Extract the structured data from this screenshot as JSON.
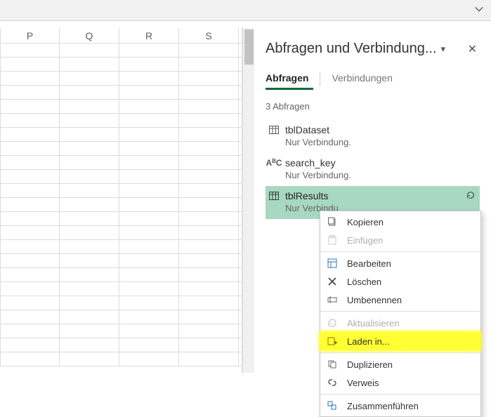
{
  "columns": [
    "P",
    "Q",
    "R",
    "S"
  ],
  "pane": {
    "title": "Abfragen und Verbindung...",
    "tabs": {
      "active": "Abfragen",
      "inactive": "Verbindungen"
    },
    "count": "3 Abfragen",
    "queries": [
      {
        "name": "tblDataset",
        "sub": "Nur Verbindung.",
        "kind": "table"
      },
      {
        "name": "search_key",
        "sub": "Nur Verbindung.",
        "kind": "text"
      },
      {
        "name": "tblResults",
        "sub": "Nur Verbindu",
        "kind": "table"
      }
    ]
  },
  "menu": {
    "copy": "Kopieren",
    "paste": "Einfügen",
    "edit": "Bearbeiten",
    "delete": "Löschen",
    "rename": "Umbenennen",
    "refresh": "Aktualisieren",
    "loadto": "Laden in...",
    "duplicate": "Duplizieren",
    "reference": "Verweis",
    "merge": "Zusammenführen"
  }
}
